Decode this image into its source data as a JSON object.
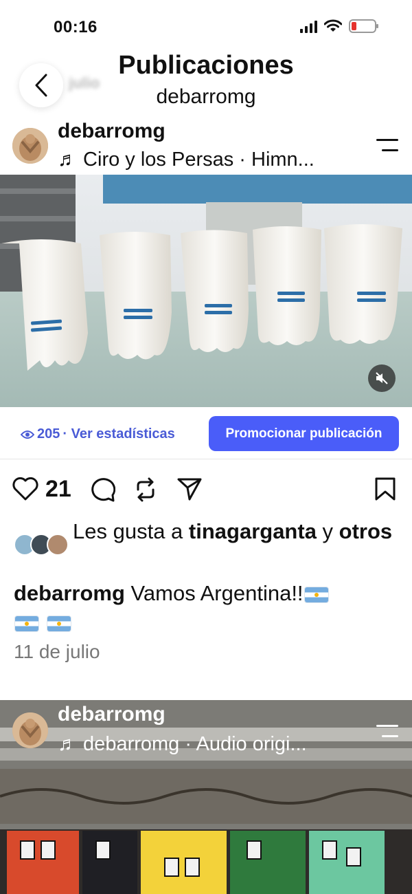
{
  "status_bar": {
    "time": "00:16"
  },
  "header": {
    "title": "Publicaciones",
    "subtitle": "debarromg"
  },
  "ghost_text": {
    "line1": "julio"
  },
  "post": {
    "username": "debarromg",
    "music": "♬ Ciro y los Persas · Himn...",
    "views": "205",
    "stats_link": "· Ver estadísticas",
    "promote_label": "Promocionar publicación",
    "like_count": "21",
    "likes_prefix": "Les gusta a ",
    "liked_by_user": "tinagarganta",
    "likes_conj": " y ",
    "likes_others": "otros",
    "caption_user": "debarromg",
    "caption_text": " Vamos Argentina!!",
    "date": "11 de julio"
  },
  "next_post": {
    "username": "debarromg",
    "music": "♬ debarromg · Audio origi..."
  },
  "colors": {
    "accent": "#4a5df9",
    "link": "#4a5bd6",
    "battery_low": "#e5322d"
  },
  "icons": [
    "back-icon",
    "menu-icon",
    "mute-icon",
    "eye-icon",
    "heart-icon",
    "comment-icon",
    "repost-icon",
    "share-icon",
    "bookmark-icon"
  ]
}
